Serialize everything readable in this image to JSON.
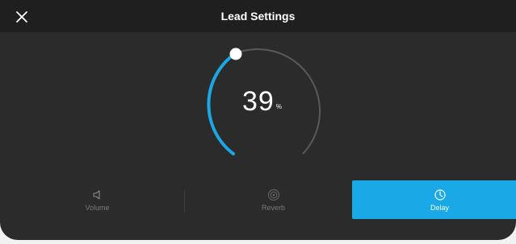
{
  "header": {
    "title": "Lead Settings"
  },
  "dial": {
    "value": "39",
    "unit": "%",
    "level": 0.39,
    "colors": {
      "active": "#1aa7e3",
      "track": "#5a5a5a",
      "knob": "#ffffff"
    }
  },
  "tabs": [
    {
      "label": "Volume",
      "icon": "speaker-icon",
      "selected": false
    },
    {
      "label": "Reverb",
      "icon": "reverb-icon",
      "selected": false
    },
    {
      "label": "Delay",
      "icon": "clock-icon",
      "selected": true
    }
  ],
  "colors": {
    "background": "#2b2b2b",
    "titlebar": "#1f1f1f",
    "accent": "#18a9e6"
  }
}
